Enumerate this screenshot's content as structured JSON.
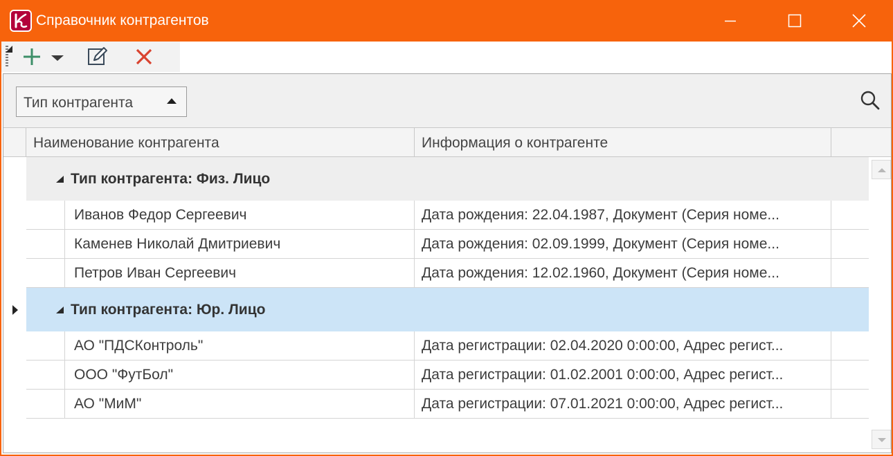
{
  "window": {
    "title": "Справочник контрагентов",
    "accent_color": "#f7630c",
    "controls": [
      "minimize-icon",
      "maximize-icon",
      "close-icon"
    ]
  },
  "toolbar": {
    "buttons": [
      {
        "name": "add",
        "icon": "plus-icon",
        "has_dropdown": true
      },
      {
        "name": "edit",
        "icon": "edit-icon"
      },
      {
        "name": "delete",
        "icon": "x-icon",
        "color": "#d9432f"
      }
    ]
  },
  "group_panel": {
    "grouped_by": "Тип контрагента",
    "sort": "ascending",
    "search_icon": "search-icon"
  },
  "grid": {
    "columns": [
      "Наименование контрагента",
      "Информация о контрагенте"
    ],
    "groups": [
      {
        "label": "Тип контрагента: Физ. Лицо",
        "expanded": true,
        "selected": false,
        "rows": [
          {
            "name": "Иванов Федор Сергеевич",
            "info": "Дата рождения: 22.04.1987, Документ (Серия номе..."
          },
          {
            "name": "Каменев Николай Дмитриевич",
            "info": "Дата рождения: 02.09.1999, Документ (Серия номе..."
          },
          {
            "name": "Петров Иван Сергеевич",
            "info": "Дата рождения: 12.02.1960, Документ (Серия номе..."
          }
        ]
      },
      {
        "label": "Тип контрагента: Юр. Лицо",
        "expanded": true,
        "selected": true,
        "rows": [
          {
            "name": "АО \"ПДСКонтроль\"",
            "info": "Дата регистрации: 02.04.2020 0:00:00, Адрес регист..."
          },
          {
            "name": "ООО \"ФутБол\"",
            "info": "Дата регистрации: 01.02.2001 0:00:00, Адрес регист..."
          },
          {
            "name": "АО \"МиМ\"",
            "info": "Дата регистрации: 07.01.2021 0:00:00, Адрес регист..."
          }
        ]
      }
    ],
    "selection_color": "#cce4f7"
  }
}
